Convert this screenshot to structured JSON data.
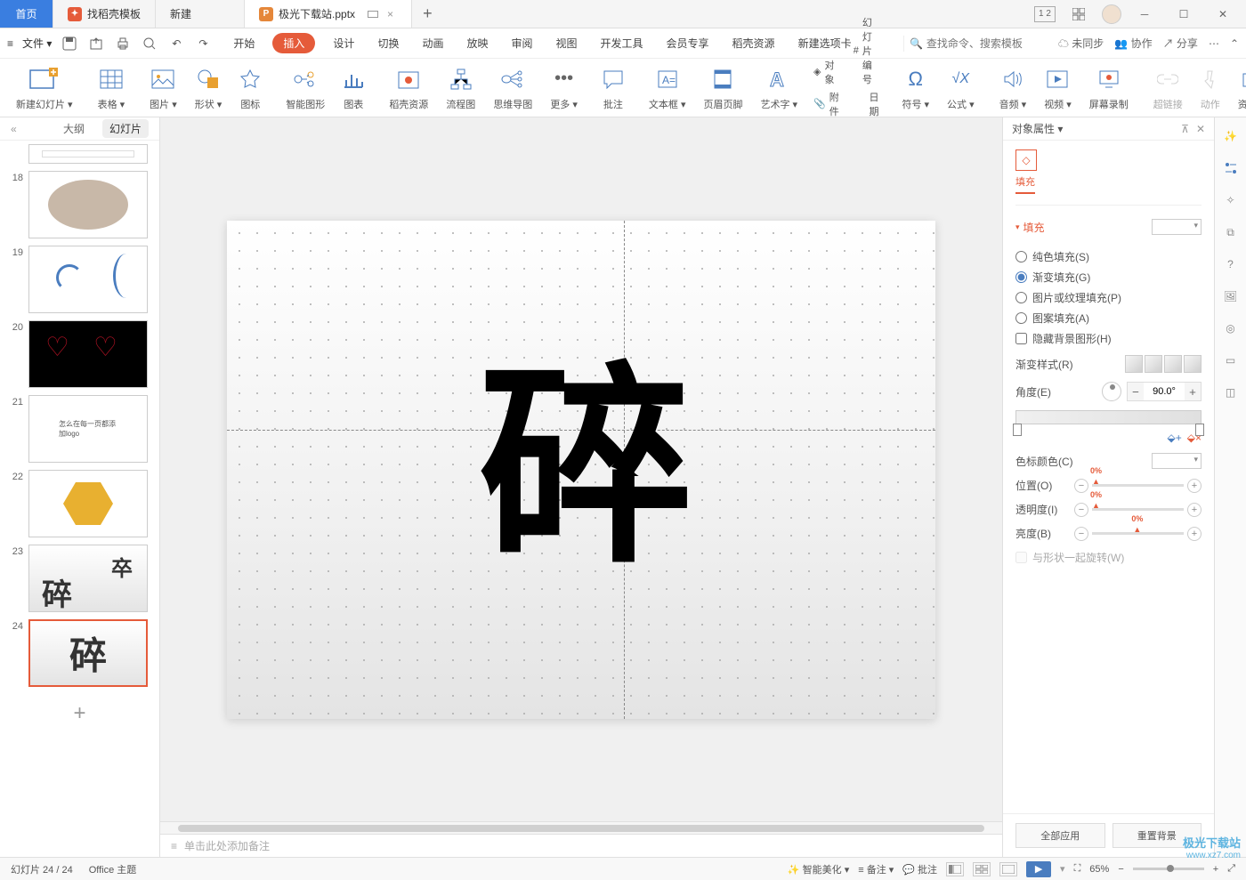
{
  "titlebar": {
    "home": "首页",
    "tabs": [
      {
        "label": "找稻壳模板"
      },
      {
        "label": "新建"
      },
      {
        "label": "极光下载站.pptx",
        "active": true
      }
    ]
  },
  "menubar": {
    "file": "文件",
    "items": [
      "开始",
      "插入",
      "设计",
      "切换",
      "动画",
      "放映",
      "审阅",
      "视图",
      "开发工具",
      "会员专享",
      "稻壳资源",
      "新建选项卡"
    ],
    "active_index": 1,
    "search_placeholder": "查找命令、搜索模板",
    "right": {
      "sync": "未同步",
      "coop": "协作",
      "share": "分享"
    }
  },
  "ribbon": {
    "items": [
      {
        "label": "新建幻灯片"
      },
      {
        "label": "表格"
      },
      {
        "label": "图片"
      },
      {
        "label": "形状"
      },
      {
        "label": "图标"
      },
      {
        "label": "智能图形"
      },
      {
        "label": "图表"
      },
      {
        "label": "稻壳资源"
      },
      {
        "label": "流程图"
      },
      {
        "label": "思维导图"
      },
      {
        "label": "更多"
      },
      {
        "label": "批注"
      },
      {
        "label": "文本框"
      },
      {
        "label": "页眉页脚"
      },
      {
        "label": "艺术字"
      },
      {
        "label": "符号"
      },
      {
        "label": "公式"
      },
      {
        "label": "音频"
      },
      {
        "label": "视频"
      },
      {
        "label": "屏幕录制"
      },
      {
        "label": "超链接"
      },
      {
        "label": "动作"
      },
      {
        "label": "资源夹"
      }
    ],
    "side": {
      "object": "对象",
      "slide_num": "幻灯片编号",
      "attach": "附件",
      "datetime": "日期和时间"
    }
  },
  "slide_panel": {
    "outline": "大纲",
    "slides_tab": "幻灯片",
    "numbers": [
      "18",
      "19",
      "20",
      "21",
      "22",
      "23",
      "24"
    ],
    "thumb21_text": "怎么在每一页都添加logo",
    "thumb23_a": "碎",
    "thumb23_b": "卒",
    "thumb24": "碎"
  },
  "canvas": {
    "char": "碎",
    "notes_placeholder": "单击此处添加备注"
  },
  "prop": {
    "title": "对象属性",
    "fill_tab": "填充",
    "section_fill": "填充",
    "solid": "纯色填充(S)",
    "gradient": "渐变填充(G)",
    "picture": "图片或纹理填充(P)",
    "pattern": "图案填充(A)",
    "hide_bg": "隐藏背景图形(H)",
    "grad_style": "渐变样式(R)",
    "angle": "角度(E)",
    "angle_value": "90.0°",
    "stop_color": "色标颜色(C)",
    "position": "位置(O)",
    "position_val": "0%",
    "transparency": "透明度(I)",
    "transparency_val": "0%",
    "brightness": "亮度(B)",
    "brightness_val": "0%",
    "rotate_with_shape": "与形状一起旋转(W)",
    "apply_all": "全部应用",
    "reset_bg": "重置背景"
  },
  "statusbar": {
    "slide_counter": "幻灯片 24 / 24",
    "theme": "Office 主题",
    "beautify": "智能美化",
    "notes": "备注",
    "comments": "批注",
    "zoom": "65%"
  },
  "watermark": {
    "name": "极光下载站",
    "url": "www.xz7.com"
  }
}
